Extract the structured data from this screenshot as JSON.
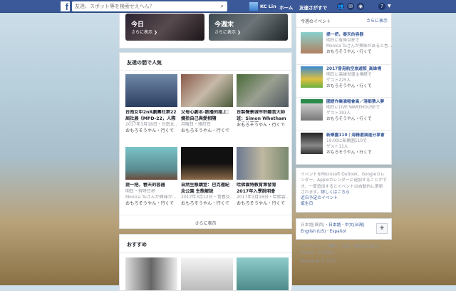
{
  "topbar": {
    "search_placeholder": "友達、スポット等を検索せえへん？",
    "user_name": "KC Lin",
    "home": "ホーム",
    "find_friends": "友達さがすで"
  },
  "hero": [
    {
      "title": "今日",
      "more": "さらに表示 ❯"
    },
    {
      "title": "今週末",
      "more": "さらに表示 ❯"
    }
  ],
  "popular": {
    "heading": "友達の間で人気",
    "more": "さらに表示",
    "events": [
      {
        "title": "台南女中2nR劇團社第22屆社展《MPD-22，人際π鏈》",
        "meta": "2017年3月18日・台南女...",
        "action": "おもろそうやん・行くで"
      },
      {
        "title": "父母心劇本-散播的路上：摘拾自己與愛相隨",
        "meta": "月曜日・雅紅豆",
        "action": "おもろそうやん・行くで"
      },
      {
        "title": "台製聲景城市聆聽音大師班：Simon Whetham 台南的聲響",
        "meta": "",
        "action": "おもろそうやん・行くで"
      },
      {
        "title": "提一把，春天的容器",
        "meta": "明日・有時甘杯",
        "meta2": "Monica Tuさんが興味が...",
        "action": "おもろそうやん・行くで"
      },
      {
        "title": "自然生態講堂：巴克禮紀念公園 生態解說",
        "meta": "2017年3月12日・青春交...",
        "action": "おもろそうやん・行くで"
      },
      {
        "title": "哈佛雲特教育第發育 2017年入學說明會",
        "meta": "2017年3月18日・哈佛雲...",
        "action": "おもろそうやん・行くで"
      }
    ]
  },
  "recommend": {
    "heading": "おすすめ"
  },
  "week": {
    "heading": "今週のイベント",
    "more": "さらに表示",
    "events": [
      {
        "title": "提一把，春天的容器",
        "l1": "明日に有時甘杯で",
        "l2": "Monica Tuさんが興味があると言...",
        "action": "おもろそうやん・行くで"
      },
      {
        "title": "2017香港航空旅遊節_高雄場",
        "l1": "明日に高雄世運主場館で",
        "l2": "ゲスト225人",
        "action": "おもろそうやん・行くで"
      },
      {
        "title": "國語作業演唱會高／港都猜人夢",
        "l1": "明日にLIVE WAREHOUSEで",
        "l2": "ゲスト193人",
        "action": "おもろそうやん・行くで"
      },
      {
        "title": "新樂園110｜海精選演進分享會",
        "l1": "19:00に新樂園110で",
        "l2": "ゲスト11人",
        "action": "おもろそうやん・行くで"
      }
    ]
  },
  "info": {
    "text": "イベントをMicrosoft Outlook、Googleカレンダー、Appleカレンダーに追加することができ、一度追加するとイベントは自動的に更新されます。",
    "link": "詳しくはこちら",
    "upcoming": "近日予定のイベント",
    "birthdays": "誕生日"
  },
  "lang": {
    "current": "日本語(関西)",
    "options": [
      "日本語",
      "中文(台灣)",
      "English (US)",
      "Español"
    ],
    "add": "+"
  },
  "footer": {
    "links": "プライバシー・規約・広告・AdChoices ▷",
    "links2": "Cookie・その他 ▾",
    "copyright": "Facebook © 2017"
  }
}
